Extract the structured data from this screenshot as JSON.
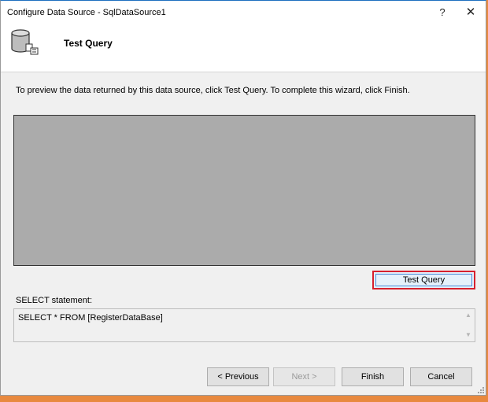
{
  "window": {
    "title": "Configure Data Source - SqlDataSource1",
    "help_glyph": "?",
    "close_glyph": "✕"
  },
  "header": {
    "icon": "database-icon",
    "title": "Test Query"
  },
  "instructions": "To preview the data returned by this data source, click Test Query. To complete this wizard, click Finish.",
  "preview": {
    "test_query_label": "Test Query"
  },
  "select_statement": {
    "label": "SELECT statement:",
    "value": "SELECT * FROM [RegisterDataBase]"
  },
  "footer": {
    "previous_label": "< Previous",
    "next_label": "Next >",
    "finish_label": "Finish",
    "cancel_label": "Cancel"
  },
  "colors": {
    "highlight_border": "#d6202e",
    "preview_background": "#ababab",
    "desktop_background": "#e8893f"
  }
}
